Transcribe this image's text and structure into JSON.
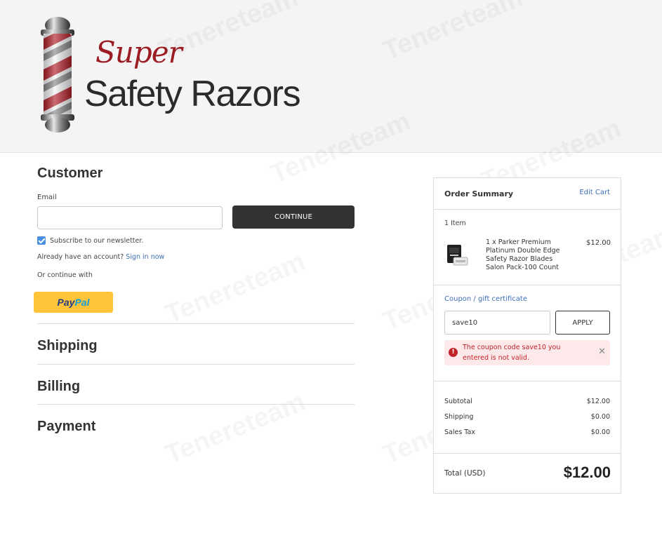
{
  "brand": {
    "super": "Super",
    "name": "Safety Razors",
    "colors": {
      "accent_red": "#9b1c22",
      "dark": "#333333",
      "link": "#3e6fb6"
    }
  },
  "watermark_text": "Tenereteam",
  "customer": {
    "title": "Customer",
    "email_label": "Email",
    "email_value": "",
    "continue_label": "CONTINUE",
    "subscribe_label": "Subscribe to our newsletter.",
    "subscribe_checked": true,
    "already_text": "Already have an account?",
    "sign_in_label": "Sign in now",
    "or_continue": "Or continue with",
    "paypal_pay": "Pay",
    "paypal_pal": "Pal"
  },
  "steps": {
    "shipping": "Shipping",
    "billing": "Billing",
    "payment": "Payment"
  },
  "summary": {
    "title": "Order Summary",
    "edit_cart": "Edit Cart",
    "item_count": "1 Item",
    "product": {
      "name": "1 x Parker Premium Platinum Double Edge Safety Razor Blades Salon Pack-100 Count",
      "price": "$12.00",
      "image_icon": "razor-blade-pack-icon"
    },
    "coupon_label": "Coupon / gift certificate",
    "coupon_value": "save10",
    "apply_label": "APPLY",
    "error_message": "The coupon code save10 you entered is not valid.",
    "subtotal_label": "Subtotal",
    "subtotal_value": "$12.00",
    "shipping_label": "Shipping",
    "shipping_value": "$0.00",
    "tax_label": "Sales Tax",
    "tax_value": "$0.00",
    "total_label": "Total (USD)",
    "total_value": "$12.00"
  }
}
